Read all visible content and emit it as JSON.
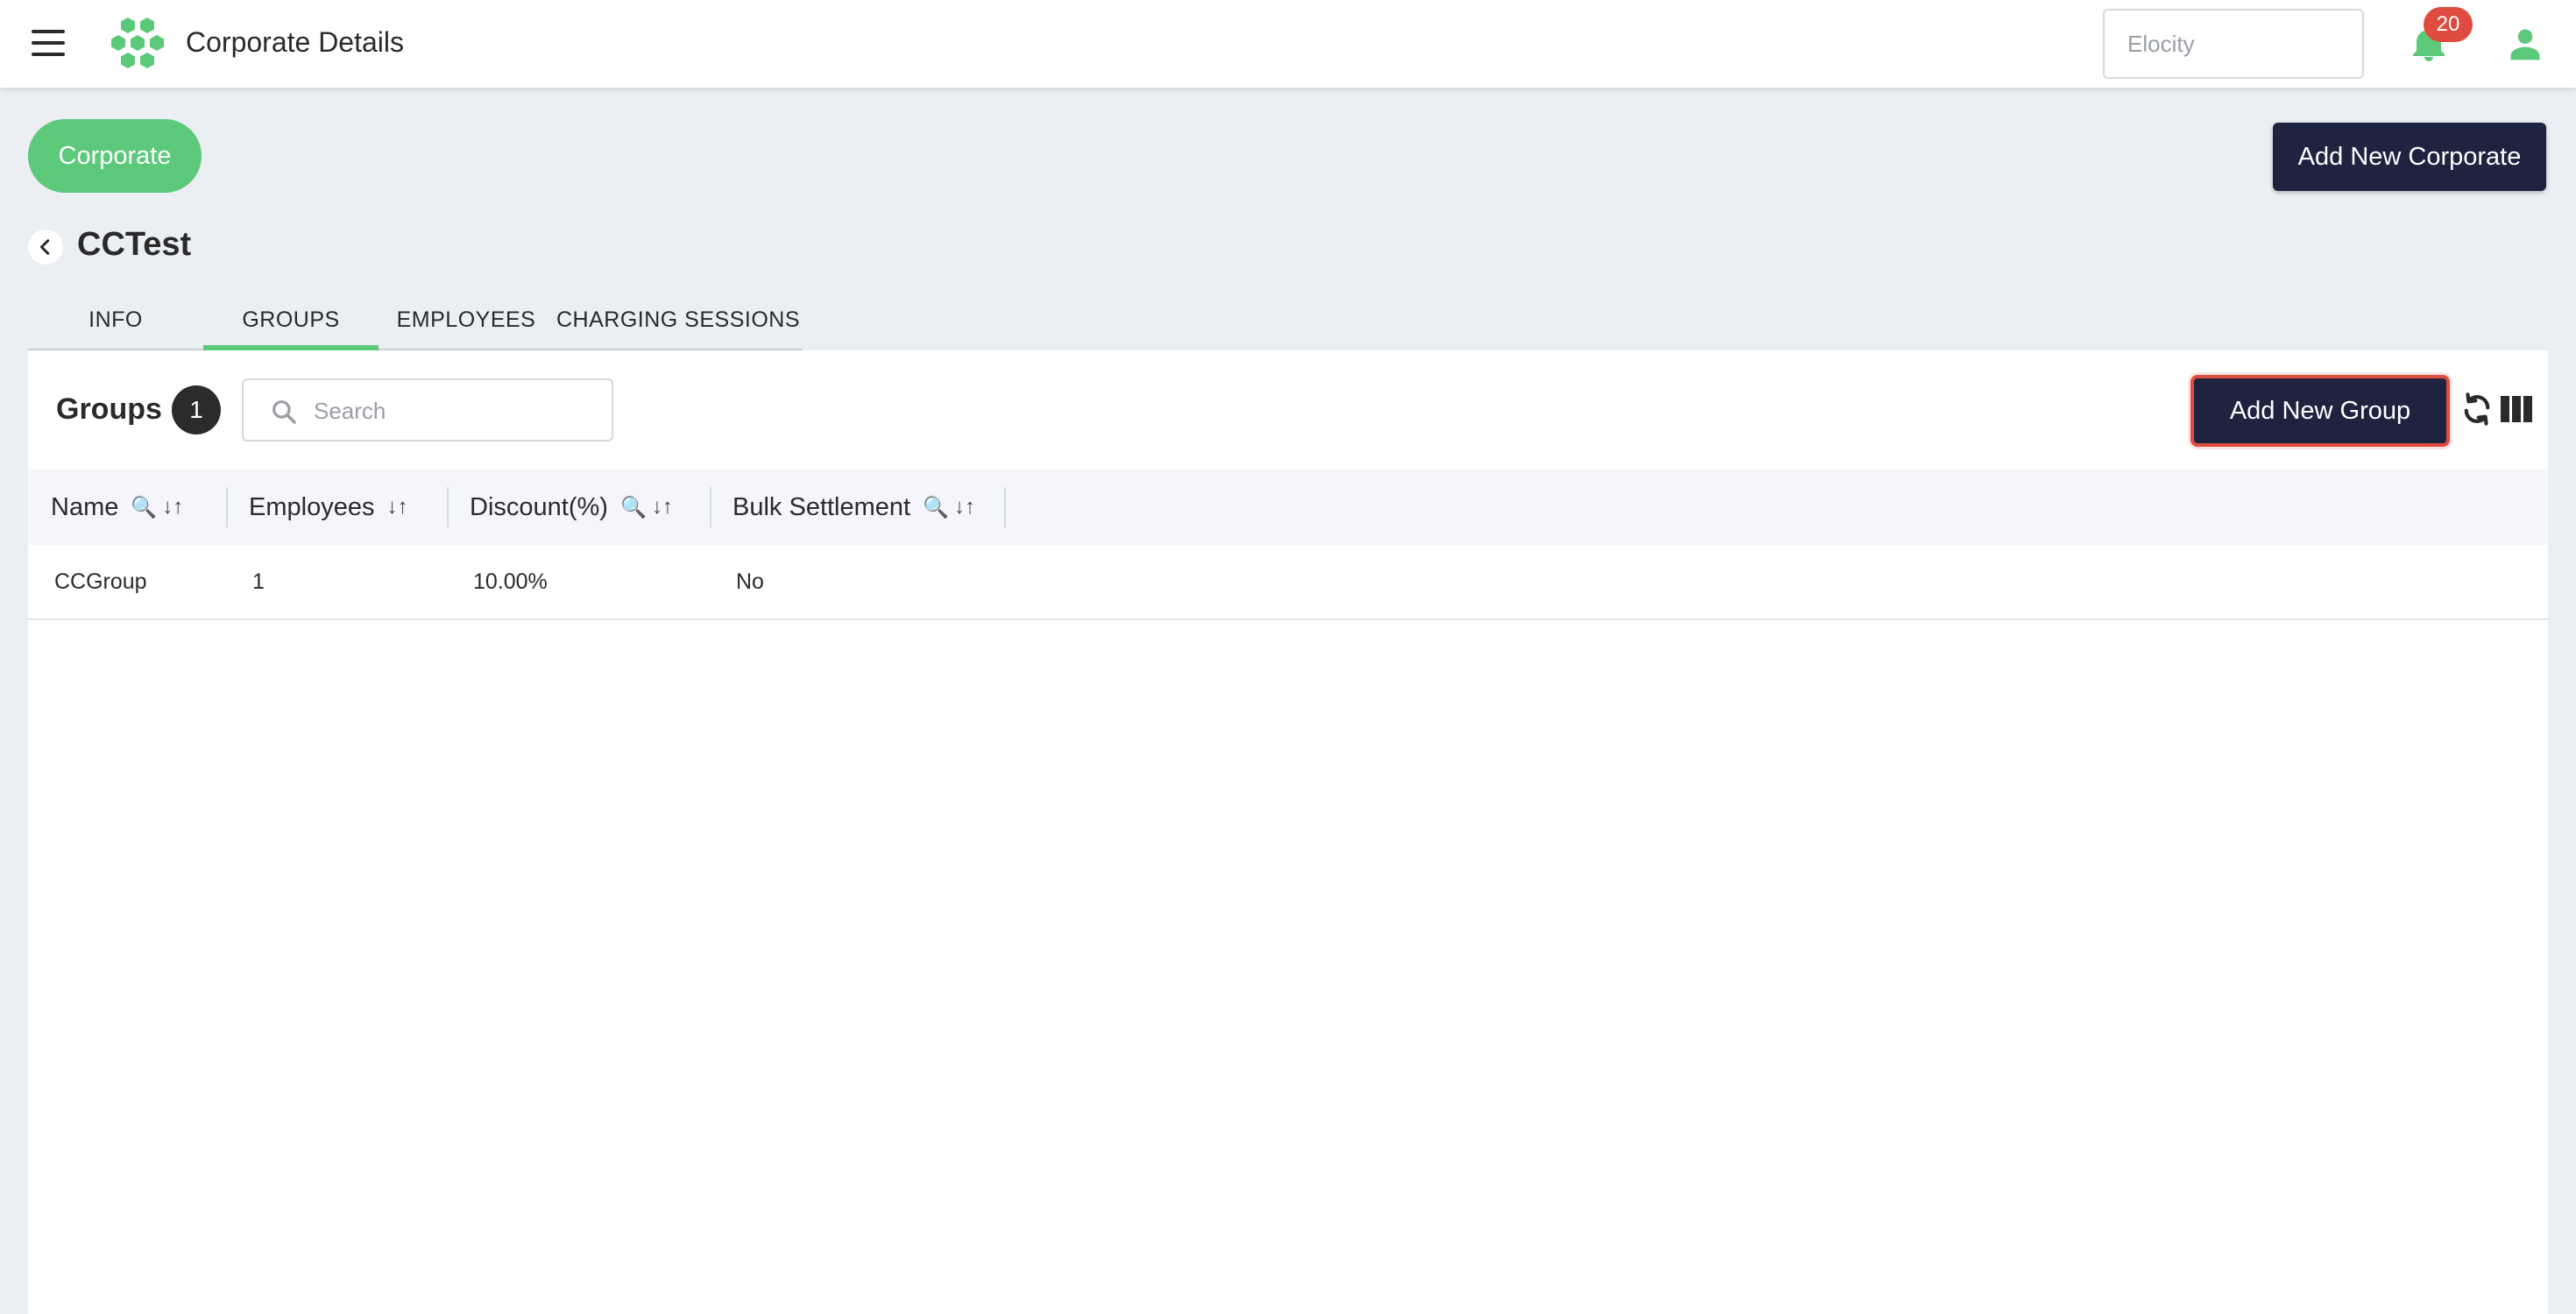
{
  "header": {
    "title": "Corporate Details",
    "tenant_placeholder": "Elocity",
    "notification_count": "20"
  },
  "colors": {
    "accent_green": "#5cc97a",
    "primary_dark": "#1e2340",
    "badge_red": "#e04b3f"
  },
  "top_actions": {
    "corporate_label": "Corporate",
    "add_corporate_label": "Add New Corporate"
  },
  "page": {
    "heading": "CCTest"
  },
  "tabs": [
    {
      "label": "INFO",
      "active": false
    },
    {
      "label": "GROUPS",
      "active": true
    },
    {
      "label": "EMPLOYEES",
      "active": false
    },
    {
      "label": "CHARGING SESSIONS",
      "active": false
    }
  ],
  "groups": {
    "title": "Groups",
    "count": "1",
    "search_placeholder": "Search",
    "add_group_label": "Add New Group"
  },
  "table": {
    "columns": [
      {
        "label": "Name",
        "search_icon": "🔍",
        "sort_icon": "↓↑"
      },
      {
        "label": "Employees",
        "sort_icon": "↓↑"
      },
      {
        "label": "Discount(%)",
        "search_icon": "🔍",
        "sort_icon": "↓↑"
      },
      {
        "label": "Bulk Settlement",
        "search_icon": "🔍",
        "sort_icon": "↓↑"
      }
    ],
    "rows": [
      {
        "name": "CCGroup",
        "employees": "1",
        "discount": "10.00%",
        "bulk_settlement": "No"
      }
    ]
  }
}
